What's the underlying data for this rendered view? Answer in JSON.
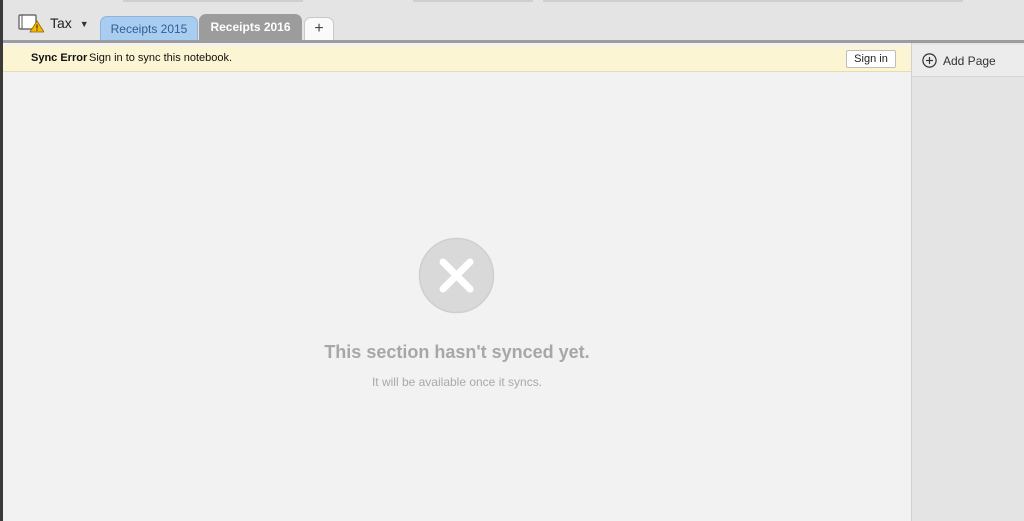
{
  "notebook": {
    "name": "Tax",
    "icon": "notebook-warning-icon"
  },
  "tabs": [
    {
      "label": "Receipts 2015",
      "color": "#a9cdf0"
    },
    {
      "label": "Receipts 2016",
      "color": "#9c9c9c",
      "active": true
    }
  ],
  "add_section_label": "+",
  "sync_bar": {
    "title": "Sync Error",
    "message": "Sign in to sync this notebook.",
    "button_label": "Sign in",
    "background": "#fcf5d4"
  },
  "content": {
    "icon": "close-circle-icon",
    "heading": "This section hasn't synced yet.",
    "subtext": "It will be available once it syncs."
  },
  "right_panel": {
    "add_page_label": "Add Page",
    "add_page_icon": "plus-circle-icon"
  }
}
